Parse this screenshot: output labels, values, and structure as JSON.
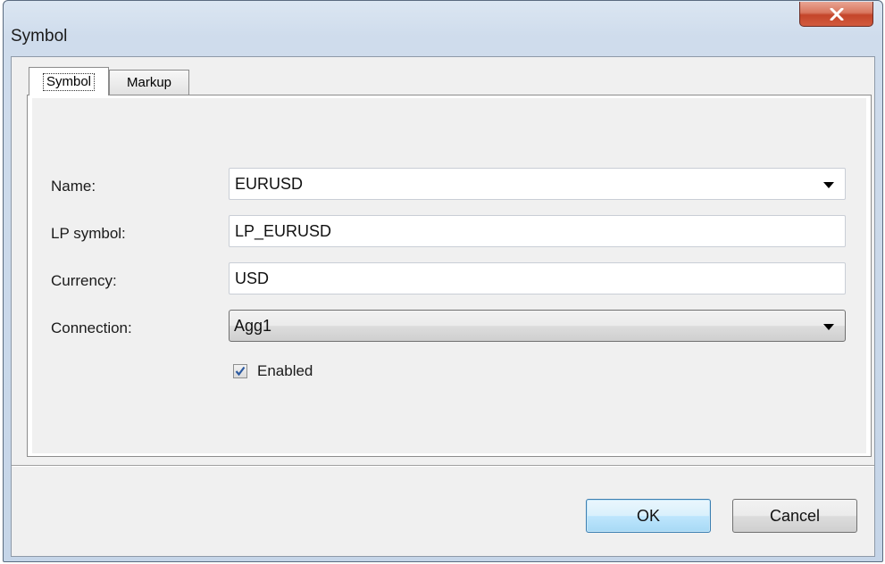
{
  "window": {
    "title": "Symbol"
  },
  "tabs": [
    {
      "label": "Symbol",
      "active": true
    },
    {
      "label": "Markup",
      "active": false
    }
  ],
  "form": {
    "name": {
      "label": "Name:",
      "value": "EURUSD"
    },
    "lp_symbol": {
      "label": "LP symbol:",
      "value": "LP_EURUSD"
    },
    "currency": {
      "label": "Currency:",
      "value": "USD"
    },
    "connection": {
      "label": "Connection:",
      "value": "Agg1"
    },
    "enabled": {
      "label": "Enabled",
      "checked": true
    }
  },
  "buttons": {
    "ok": "OK",
    "cancel": "Cancel"
  },
  "colors": {
    "close_button": "#c4452a",
    "checkmark": "#2c5aa0",
    "default_button_border": "#3c7fb1"
  },
  "icons": {
    "close": "close-icon",
    "dropdown": "chevron-down-icon",
    "check": "checkmark-icon"
  }
}
